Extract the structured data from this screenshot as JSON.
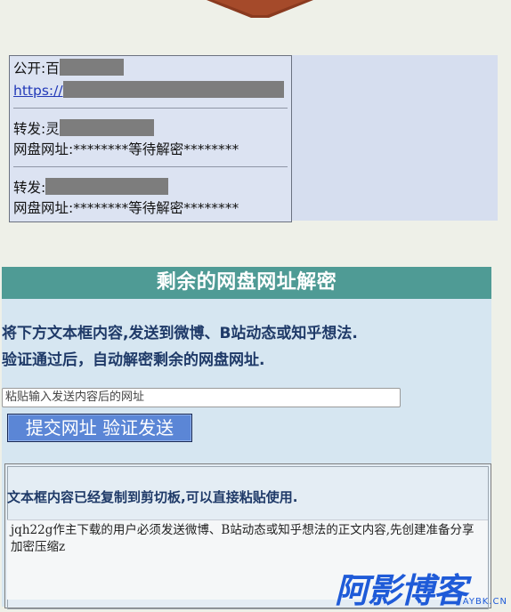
{
  "links": {
    "public": {
      "label": "公开:",
      "prefix_char": "百",
      "url_prefix": "https://"
    },
    "forwards": [
      {
        "label": "转发:",
        "prefix_char": "灵",
        "address_label": "网盘网址:",
        "address_value": "********等待解密********"
      },
      {
        "label": "转发:",
        "address_label": "网盘网址:",
        "address_value": "********等待解密********"
      }
    ]
  },
  "verify": {
    "title": "剩余的网盘网址解密",
    "instruction_line1": "将下方文本框内容,发送到微博、B站动态或知乎想法.",
    "instruction_line2": "验证通过后，自动解密剩余的网盘网址.",
    "url_placeholder": "粘贴输入发送内容后的网址",
    "submit_label": "提交网址 验证发送",
    "copy_hint": "文本框内容已经复制到剪切板,可以直接粘贴使用.",
    "copy_text": "jqh22g作主下载的用户必须发送微博、B站动态或知乎想法的正文内容,先创建准备分享加密压缩z"
  },
  "watermark": {
    "main": "阿影博客",
    "sub": "AYBK.CN"
  },
  "colors": {
    "accent_bar": "#4f9b95",
    "button": "#5b86d6",
    "link": "#2239b8",
    "watermark": "#1f5bd8"
  }
}
